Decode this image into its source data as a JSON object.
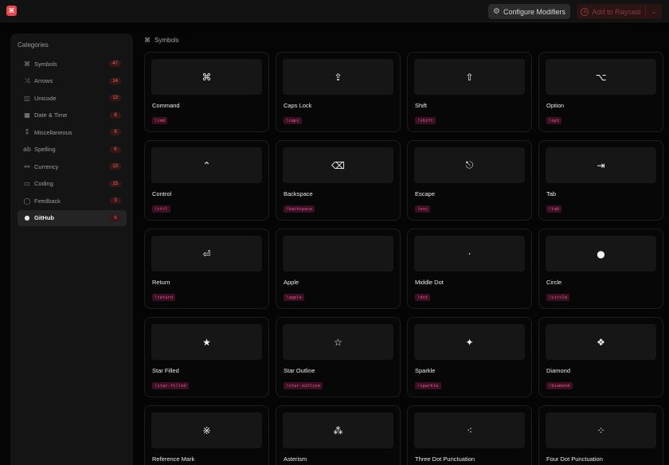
{
  "app": {
    "logo_glyph": "⌘",
    "configure_label": "Configure Modifiers",
    "add_label": "Add to Raycast"
  },
  "sidebar": {
    "title": "Categories",
    "items": [
      {
        "label": "Symbols",
        "icon": "⌘",
        "count": "47",
        "active": false
      },
      {
        "label": "Arrows",
        "icon": "⤨",
        "count": "14",
        "active": false
      },
      {
        "label": "Unicode",
        "icon": "◫",
        "count": "13",
        "active": false
      },
      {
        "label": "Date & Time",
        "icon": "▦",
        "count": "8",
        "active": false
      },
      {
        "label": "Miscellaneous",
        "icon": "⁑",
        "count": "8",
        "active": false
      },
      {
        "label": "Spelling",
        "icon": "ab",
        "count": "6",
        "active": false
      },
      {
        "label": "Currency",
        "icon": "⚯",
        "count": "13",
        "active": false
      },
      {
        "label": "Coding",
        "icon": "▭",
        "count": "15",
        "active": false
      },
      {
        "label": "Feedback",
        "icon": "◯",
        "count": "3",
        "active": false
      },
      {
        "label": "GitHub",
        "icon": "●",
        "count": "6",
        "active": true
      }
    ]
  },
  "section": {
    "title": "Symbols",
    "icon": "⌘"
  },
  "cards": [
    {
      "glyph": "⌘",
      "name": "Command",
      "keyword": "!cmd"
    },
    {
      "glyph": "⇪",
      "name": "Caps Lock",
      "keyword": "!caps"
    },
    {
      "glyph": "⇧",
      "name": "Shift",
      "keyword": "!shift"
    },
    {
      "glyph": "⌥",
      "name": "Option",
      "keyword": "!opt"
    },
    {
      "glyph": "⌃",
      "name": "Control",
      "keyword": "!ctrl"
    },
    {
      "glyph": "⌫",
      "name": "Backspace",
      "keyword": "!backspace"
    },
    {
      "glyph": "⎋",
      "name": "Escape",
      "keyword": "!esc"
    },
    {
      "glyph": "⇥",
      "name": "Tab",
      "keyword": "!tab"
    },
    {
      "glyph": "⏎",
      "name": "Return",
      "keyword": "!return"
    },
    {
      "glyph": "",
      "name": "Apple",
      "keyword": "!apple"
    },
    {
      "glyph": "·",
      "name": "Middle Dot",
      "keyword": "!dot"
    },
    {
      "glyph": "●",
      "name": "Circle",
      "keyword": "!circle"
    },
    {
      "glyph": "★",
      "name": "Star Filled",
      "keyword": "!star-filled"
    },
    {
      "glyph": "☆",
      "name": "Star Outline",
      "keyword": "!star-outline"
    },
    {
      "glyph": "✦",
      "name": "Sparkle",
      "keyword": "!sparkle"
    },
    {
      "glyph": "❖",
      "name": "Diamond",
      "keyword": "!diamond"
    },
    {
      "glyph": "※",
      "name": "Reference Mark",
      "keyword": "!reference"
    },
    {
      "glyph": "⁂",
      "name": "Asterism",
      "keyword": "!asterism"
    },
    {
      "glyph": "⁖",
      "name": "Three Dot Punctuation",
      "keyword": "!three-dot"
    },
    {
      "glyph": "⁘",
      "name": "Four Dot Punctuation",
      "keyword": "!four-dot"
    }
  ],
  "colors": {
    "accent": "#e5484d",
    "keyword_text": "#e05a8a",
    "keyword_bg": "#3b0f24"
  }
}
